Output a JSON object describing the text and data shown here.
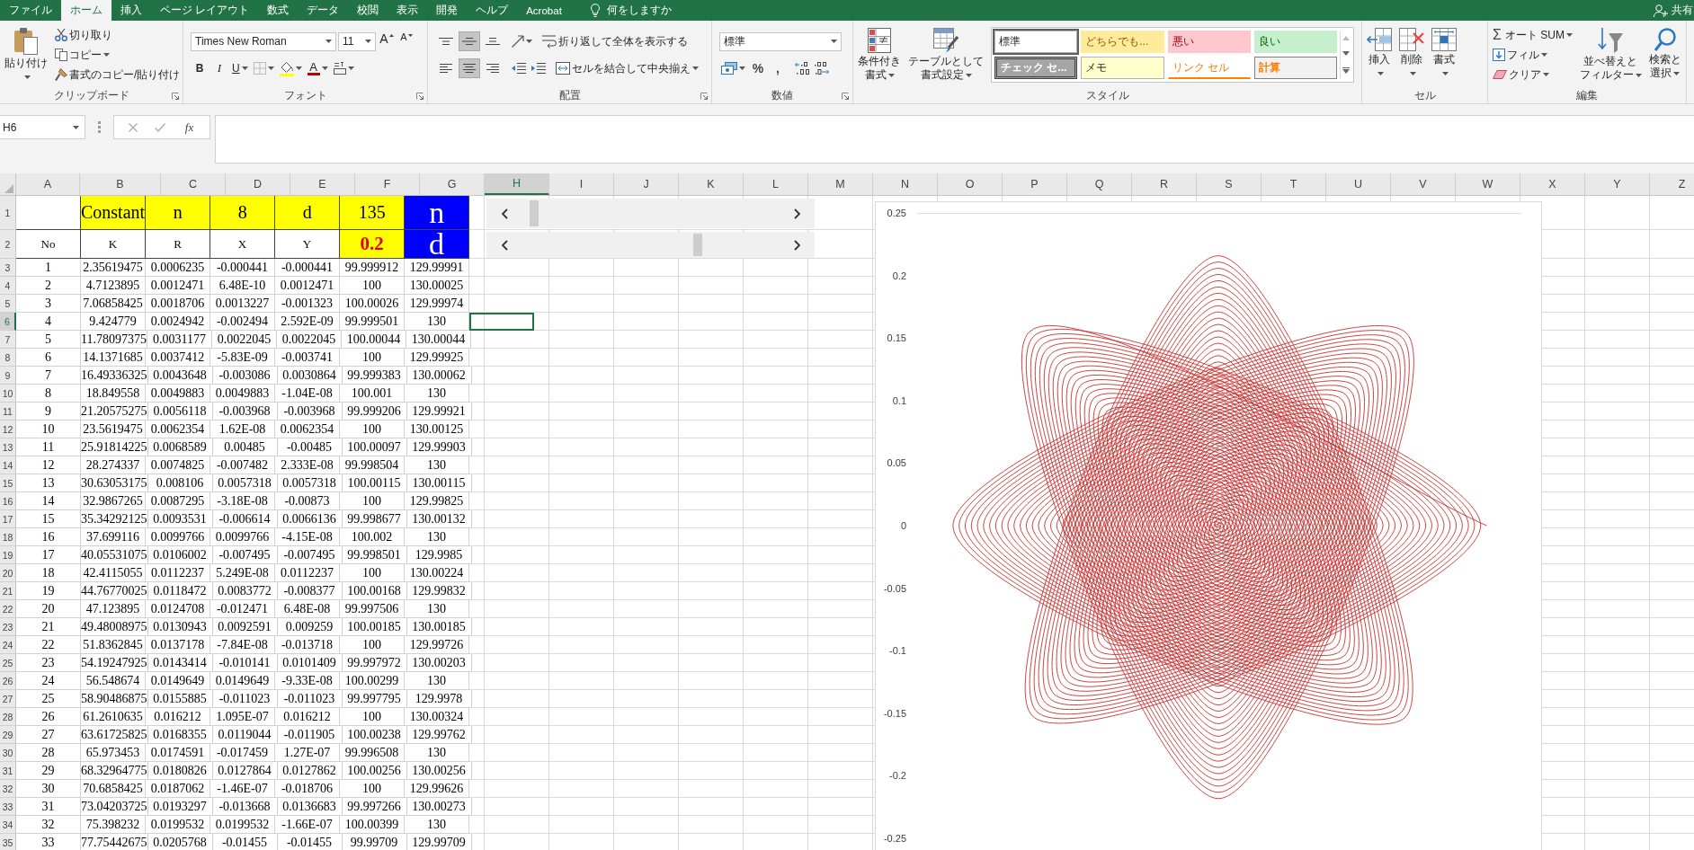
{
  "menu_bar": {
    "tabs": [
      {
        "label": "ファイル",
        "selected": false
      },
      {
        "label": "ホーム",
        "selected": true
      },
      {
        "label": "挿入",
        "selected": false
      },
      {
        "label": "ページ レイアウト",
        "selected": false
      },
      {
        "label": "数式",
        "selected": false
      },
      {
        "label": "データ",
        "selected": false
      },
      {
        "label": "校閲",
        "selected": false
      },
      {
        "label": "表示",
        "selected": false
      },
      {
        "label": "開発",
        "selected": false
      },
      {
        "label": "ヘルプ",
        "selected": false
      },
      {
        "label": "Acrobat",
        "selected": false
      }
    ],
    "tell_me": "何をしますか",
    "share": "共有"
  },
  "ribbon": {
    "clipboard": {
      "label": "クリップボード",
      "paste": "貼り付け",
      "cut": "切り取り",
      "copy": "コピー",
      "format_painter": "書式のコピー/貼り付け"
    },
    "font": {
      "label": "フォント",
      "name": "Times New Roman",
      "size": "11",
      "grow": "A",
      "shrink": "A",
      "styles": [
        "B",
        "I",
        "U"
      ],
      "font_color": "A"
    },
    "alignment": {
      "label": "配置",
      "vertical": [
        {
          "kind": "top",
          "selected": false
        },
        {
          "kind": "middle",
          "selected": true
        },
        {
          "kind": "bottom",
          "selected": false
        }
      ],
      "horizontal": [
        {
          "kind": "left",
          "selected": false
        },
        {
          "kind": "center",
          "selected": true
        },
        {
          "kind": "right",
          "selected": false
        }
      ],
      "wrap": "折り返して全体を表示する",
      "merge": "セルを結合して中央揃え"
    },
    "number": {
      "label": "数値",
      "format": "標準",
      "percent": "%",
      "comma": ","
    },
    "styles": {
      "label": "スタイル",
      "conditional": [
        "条件付き",
        "書式"
      ],
      "as_table": [
        "テーブルとして",
        "書式設定"
      ],
      "gallery": [
        {
          "text": "標準",
          "kind": "normal",
          "selected": true
        },
        {
          "text": "どちらでも...",
          "kind": "neutral",
          "selected": false
        },
        {
          "text": "悪い",
          "kind": "bad",
          "selected": false
        },
        {
          "text": "良い",
          "kind": "good",
          "selected": false
        },
        {
          "text": "チェック セ...",
          "kind": "check",
          "selected": false
        },
        {
          "text": "メモ",
          "kind": "note",
          "selected": false
        },
        {
          "text": "リンク セル",
          "kind": "linked",
          "selected": false
        },
        {
          "text": "計算",
          "kind": "calculation",
          "selected": false
        }
      ]
    },
    "cells": {
      "label": "セル",
      "buttons": [
        {
          "kind": "insert",
          "text": "挿入"
        },
        {
          "kind": "delete",
          "text": "削除"
        },
        {
          "kind": "format",
          "text": "書式"
        }
      ]
    },
    "editing": {
      "label": "編集",
      "autosum_symbol": "Σ",
      "autosum": "オート SUM",
      "fill": "フィル",
      "clear": "クリア",
      "sort_filter": [
        "並べ替えと",
        "フィルター"
      ],
      "find_select": [
        "検索と",
        "選択"
      ]
    }
  },
  "formula_bar": {
    "name_box": "H6",
    "function_label": "fx"
  },
  "sheet": {
    "columns": [
      {
        "label": "A",
        "selected": false
      },
      {
        "label": "B",
        "selected": false
      },
      {
        "label": "C",
        "selected": false
      },
      {
        "label": "D",
        "selected": false
      },
      {
        "label": "E",
        "selected": false
      },
      {
        "label": "F",
        "selected": false
      },
      {
        "label": "G",
        "selected": false
      },
      {
        "label": "H",
        "selected": true
      },
      {
        "label": "I",
        "selected": false
      },
      {
        "label": "J",
        "selected": false
      },
      {
        "label": "K",
        "selected": false
      },
      {
        "label": "L",
        "selected": false
      },
      {
        "label": "M",
        "selected": false
      },
      {
        "label": "N",
        "selected": false
      },
      {
        "label": "O",
        "selected": false
      },
      {
        "label": "P",
        "selected": false
      },
      {
        "label": "Q",
        "selected": false
      },
      {
        "label": "R",
        "selected": false
      },
      {
        "label": "S",
        "selected": false
      },
      {
        "label": "T",
        "selected": false
      },
      {
        "label": "U",
        "selected": false
      },
      {
        "label": "V",
        "selected": false
      },
      {
        "label": "W",
        "selected": false
      },
      {
        "label": "X",
        "selected": false
      },
      {
        "label": "Y",
        "selected": false
      },
      {
        "label": "Z",
        "selected": false
      }
    ],
    "rows": [
      {
        "number": "1",
        "kind": "title",
        "selected": false,
        "cells": [
          null,
          {
            "text": "Constant",
            "color": "#ffff00",
            "emphasis": false
          },
          {
            "text": "n",
            "color": "#ffff00",
            "emphasis": false
          },
          {
            "text": "8",
            "color": "#ffff00",
            "emphasis": false
          },
          {
            "text": "d",
            "color": "#ffff00",
            "emphasis": false
          },
          {
            "text": "135",
            "color": "#ffff00",
            "emphasis": false
          },
          {
            "text": "n",
            "color": "#0000ff",
            "emphasis": false
          }
        ]
      },
      {
        "number": "2",
        "kind": "heading",
        "selected": false,
        "cells": [
          {
            "text": "No",
            "color": "#ffffff",
            "emphasis": false
          },
          {
            "text": "K",
            "color": "#ffffff",
            "emphasis": false
          },
          {
            "text": "R",
            "color": "#ffffff",
            "emphasis": false
          },
          {
            "text": "X",
            "color": "#ffffff",
            "emphasis": false
          },
          {
            "text": "Y",
            "color": "#ffffff",
            "emphasis": false
          },
          {
            "text": "0.2",
            "color": "#ffff00",
            "emphasis": true
          },
          {
            "text": "d",
            "color": "#0000ff",
            "emphasis": false
          }
        ]
      },
      {
        "number": "3",
        "kind": "data",
        "selected": false,
        "cells": [
          "1",
          "2.35619475",
          "0.0006235",
          "-0.000441",
          "-0.000441",
          "99.999912",
          "129.99991"
        ]
      },
      {
        "number": "4",
        "kind": "data",
        "selected": false,
        "cells": [
          "2",
          "4.7123895",
          "0.0012471",
          "6.48E-10",
          "0.0012471",
          "100",
          "130.00025"
        ]
      },
      {
        "number": "5",
        "kind": "data",
        "selected": false,
        "cells": [
          "3",
          "7.06858425",
          "0.0018706",
          "0.0013227",
          "-0.001323",
          "100.00026",
          "129.99974"
        ]
      },
      {
        "number": "6",
        "kind": "data",
        "selected": true,
        "cells": [
          "4",
          "9.424779",
          "0.0024942",
          "-0.002494",
          "2.592E-09",
          "99.999501",
          "130"
        ]
      },
      {
        "number": "7",
        "kind": "data",
        "selected": false,
        "cells": [
          "5",
          "11.78097375",
          "0.0031177",
          "0.0022045",
          "0.0022045",
          "100.00044",
          "130.00044"
        ]
      },
      {
        "number": "8",
        "kind": "data",
        "selected": false,
        "cells": [
          "6",
          "14.1371685",
          "0.0037412",
          "-5.83E-09",
          "-0.003741",
          "100",
          "129.99925"
        ]
      },
      {
        "number": "9",
        "kind": "data",
        "selected": false,
        "cells": [
          "7",
          "16.49336325",
          "0.0043648",
          "-0.003086",
          "0.0030864",
          "99.999383",
          "130.00062"
        ]
      },
      {
        "number": "10",
        "kind": "data",
        "selected": false,
        "cells": [
          "8",
          "18.849558",
          "0.0049883",
          "0.0049883",
          "-1.04E-08",
          "100.001",
          "130"
        ]
      },
      {
        "number": "11",
        "kind": "data",
        "selected": false,
        "cells": [
          "9",
          "21.20575275",
          "0.0056118",
          "-0.003968",
          "-0.003968",
          "99.999206",
          "129.99921"
        ]
      },
      {
        "number": "12",
        "kind": "data",
        "selected": false,
        "cells": [
          "10",
          "23.5619475",
          "0.0062354",
          "1.62E-08",
          "0.0062354",
          "100",
          "130.00125"
        ]
      },
      {
        "number": "13",
        "kind": "data",
        "selected": false,
        "cells": [
          "11",
          "25.91814225",
          "0.0068589",
          "0.00485",
          "-0.00485",
          "100.00097",
          "129.99903"
        ]
      },
      {
        "number": "14",
        "kind": "data",
        "selected": false,
        "cells": [
          "12",
          "28.274337",
          "0.0074825",
          "-0.007482",
          "2.333E-08",
          "99.998504",
          "130"
        ]
      },
      {
        "number": "15",
        "kind": "data",
        "selected": false,
        "cells": [
          "13",
          "30.63053175",
          "0.008106",
          "0.0057318",
          "0.0057318",
          "100.00115",
          "130.00115"
        ]
      },
      {
        "number": "16",
        "kind": "data",
        "selected": false,
        "cells": [
          "14",
          "32.9867265",
          "0.0087295",
          "-3.18E-08",
          "-0.00873",
          "100",
          "129.99825"
        ]
      },
      {
        "number": "17",
        "kind": "data",
        "selected": false,
        "cells": [
          "15",
          "35.34292125",
          "0.0093531",
          "-0.006614",
          "0.0066136",
          "99.998677",
          "130.00132"
        ]
      },
      {
        "number": "18",
        "kind": "data",
        "selected": false,
        "cells": [
          "16",
          "37.699116",
          "0.0099766",
          "0.0099766",
          "-4.15E-08",
          "100.002",
          "130"
        ]
      },
      {
        "number": "19",
        "kind": "data",
        "selected": false,
        "cells": [
          "17",
          "40.05531075",
          "0.0106002",
          "-0.007495",
          "-0.007495",
          "99.998501",
          "129.9985"
        ]
      },
      {
        "number": "20",
        "kind": "data",
        "selected": false,
        "cells": [
          "18",
          "42.4115055",
          "0.0112237",
          "5.249E-08",
          "0.0112237",
          "100",
          "130.00224"
        ]
      },
      {
        "number": "21",
        "kind": "data",
        "selected": false,
        "cells": [
          "19",
          "44.76770025",
          "0.0118472",
          "0.0083772",
          "-0.008377",
          "100.00168",
          "129.99832"
        ]
      },
      {
        "number": "22",
        "kind": "data",
        "selected": false,
        "cells": [
          "20",
          "47.123895",
          "0.0124708",
          "-0.012471",
          "6.48E-08",
          "99.997506",
          "130"
        ]
      },
      {
        "number": "23",
        "kind": "data",
        "selected": false,
        "cells": [
          "21",
          "49.48008975",
          "0.0130943",
          "0.0092591",
          "0.009259",
          "100.00185",
          "130.00185"
        ]
      },
      {
        "number": "24",
        "kind": "data",
        "selected": false,
        "cells": [
          "22",
          "51.8362845",
          "0.0137178",
          "-7.84E-08",
          "-0.013718",
          "100",
          "129.99726"
        ]
      },
      {
        "number": "25",
        "kind": "data",
        "selected": false,
        "cells": [
          "23",
          "54.19247925",
          "0.0143414",
          "-0.010141",
          "0.0101409",
          "99.997972",
          "130.00203"
        ]
      },
      {
        "number": "26",
        "kind": "data",
        "selected": false,
        "cells": [
          "24",
          "56.548674",
          "0.0149649",
          "0.0149649",
          "-9.33E-08",
          "100.00299",
          "130"
        ]
      },
      {
        "number": "27",
        "kind": "data",
        "selected": false,
        "cells": [
          "25",
          "58.90486875",
          "0.0155885",
          "-0.011023",
          "-0.011023",
          "99.997795",
          "129.9978"
        ]
      },
      {
        "number": "28",
        "kind": "data",
        "selected": false,
        "cells": [
          "26",
          "61.2610635",
          "0.016212",
          "1.095E-07",
          "0.016212",
          "100",
          "130.00324"
        ]
      },
      {
        "number": "29",
        "kind": "data",
        "selected": false,
        "cells": [
          "27",
          "63.61725825",
          "0.0168355",
          "0.0119044",
          "-0.011905",
          "100.00238",
          "129.99762"
        ]
      },
      {
        "number": "30",
        "kind": "data",
        "selected": false,
        "cells": [
          "28",
          "65.973453",
          "0.0174591",
          "-0.017459",
          "1.27E-07",
          "99.996508",
          "130"
        ]
      },
      {
        "number": "31",
        "kind": "data",
        "selected": false,
        "cells": [
          "29",
          "68.32964775",
          "0.0180826",
          "0.0127864",
          "0.0127862",
          "100.00256",
          "130.00256"
        ]
      },
      {
        "number": "32",
        "kind": "data",
        "selected": false,
        "cells": [
          "30",
          "70.6858425",
          "0.0187062",
          "-1.46E-07",
          "-0.018706",
          "100",
          "129.99626"
        ]
      },
      {
        "number": "33",
        "kind": "data",
        "selected": false,
        "cells": [
          "31",
          "73.04203725",
          "0.0193297",
          "-0.013668",
          "0.0136683",
          "99.997266",
          "130.00273"
        ]
      },
      {
        "number": "34",
        "kind": "data",
        "selected": false,
        "cells": [
          "32",
          "75.398232",
          "0.0199532",
          "0.0199532",
          "-1.66E-07",
          "100.00399",
          "130"
        ]
      },
      {
        "number": "35",
        "kind": "data",
        "selected": false,
        "cells": [
          "33",
          "77.75442675",
          "0.0205768",
          "-0.01455",
          "-0.01455",
          "99.99709",
          "129.99709"
        ]
      }
    ],
    "sliders": [
      {
        "level": 0.03
      },
      {
        "level": 0.69
      }
    ]
  },
  "chart": {
    "y_axis_labels": [
      "0.25",
      "0.2",
      "0.15",
      "0.1",
      "0.05",
      "0",
      "-0.05",
      "-0.1",
      "-0.15",
      "-0.2",
      "-0.25"
    ]
  }
}
